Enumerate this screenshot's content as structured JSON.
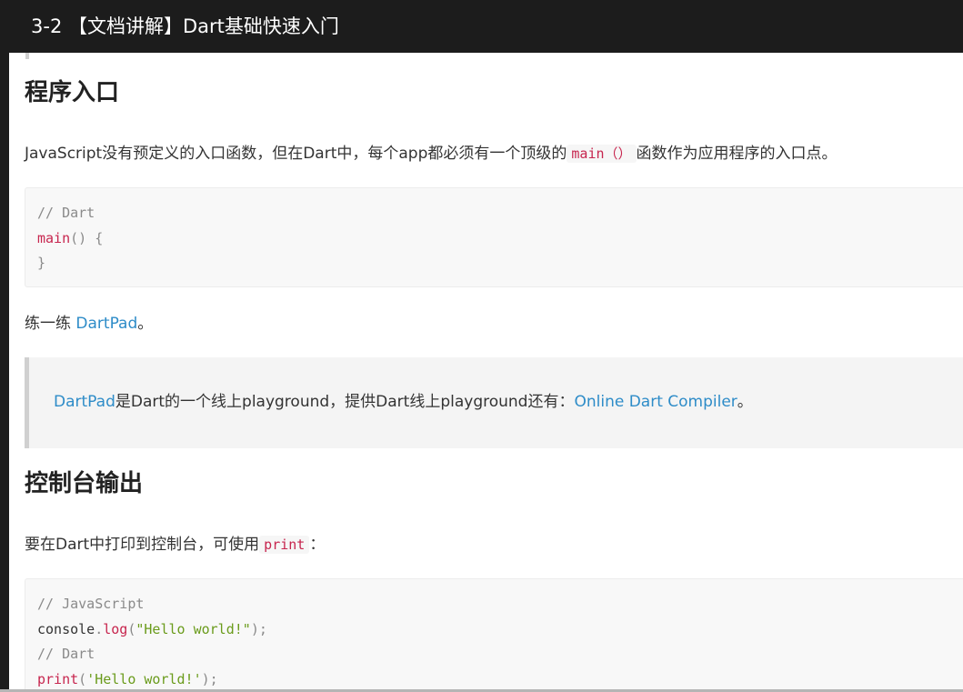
{
  "window": {
    "title": "3-2 【文档讲解】Dart基础快速入门"
  },
  "section1": {
    "heading": "程序入口",
    "para_before": "JavaScript没有预定义的入口函数，但在Dart中，每个app都必须有一个顶级的",
    "para_code": "main（）",
    "para_after": "函数作为应用程序的入口点。",
    "code": {
      "line1_comment": "// Dart",
      "line2_fn": "main",
      "line2_rest": "() {",
      "line3": "}"
    },
    "practice_prefix": "练一练 ",
    "practice_link": "DartPad",
    "practice_suffix": "。"
  },
  "note": {
    "link1": "DartPad",
    "text": "是Dart的一个线上playground，提供Dart线上playground还有：",
    "link2": "Online Dart Compiler",
    "suffix": "。"
  },
  "section2": {
    "heading": "控制台输出",
    "para_before": "要在Dart中打印到控制台，可使用",
    "para_code": "print",
    "para_after": "：",
    "code": {
      "line1_comment": "// JavaScript",
      "line2_obj": "console",
      "line2_dot": ".",
      "line2_fn": "log",
      "line2_open": "(",
      "line2_str": "\"Hello world!\"",
      "line2_close": ");",
      "line3_comment": "// Dart",
      "line4_fn": "print",
      "line4_open": "(",
      "line4_str": "'Hello world!'",
      "line4_close": ");"
    }
  }
}
